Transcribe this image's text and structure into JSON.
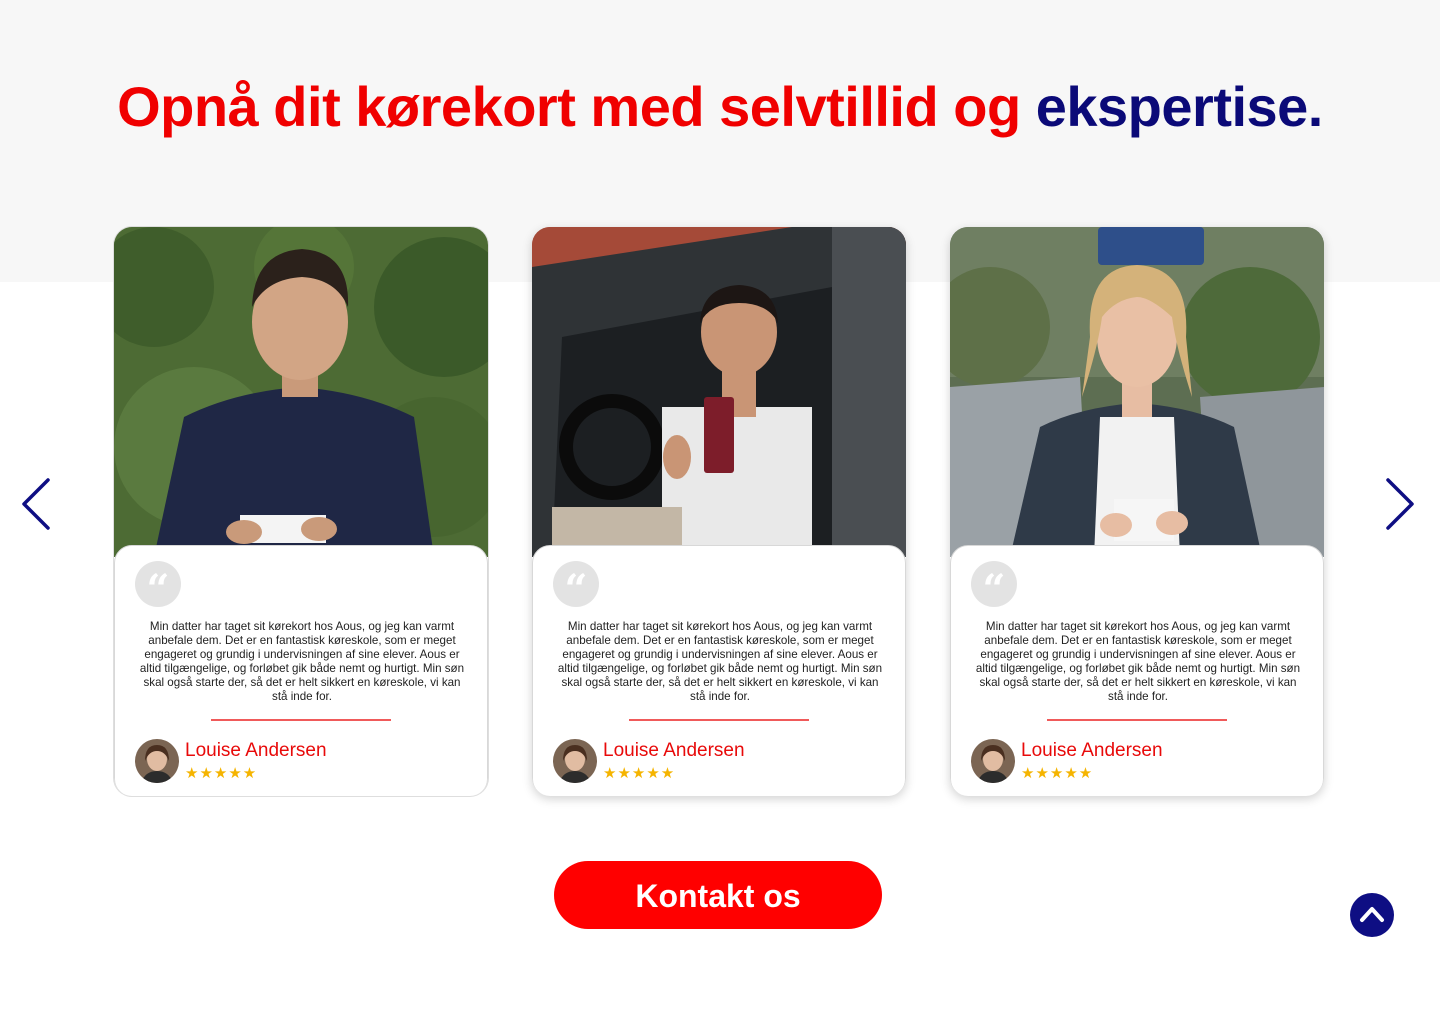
{
  "headline": {
    "red_part": "Opnå dit kørekort med selvtillid og",
    "blue_part": "ekspertise."
  },
  "colors": {
    "accent_red": "#f00000",
    "brand_blue": "#0b0a78",
    "star_gold": "#f5b400"
  },
  "carousel": {
    "prev_icon": "chevron-left-icon",
    "next_icon": "chevron-right-icon",
    "cards": [
      {
        "review": "Min datter har taget sit kørekort hos Aous, og jeg kan varmt anbefale dem. Det er en fantastisk køreskole, som er meget engageret og grundig i undervisningen af sine elever. Aous er altid tilgængelige, og forløbet gik både nemt og hurtigt. Min søn skal også starte der, så det er helt sikkert en køreskole, vi kan stå inde for.",
        "author": "Louise Andersen",
        "stars": "★★★★★",
        "rating": 5
      },
      {
        "review": "Min datter har taget sit kørekort hos Aous, og jeg kan varmt anbefale dem. Det er en fantastisk køreskole, som er meget engageret og grundig i undervisningen af sine elever. Aous er altid tilgængelige, og forløbet gik både nemt og hurtigt. Min søn skal også starte der, så det er helt sikkert en køreskole, vi kan stå inde for.",
        "author": "Louise Andersen",
        "stars": "★★★★★",
        "rating": 5
      },
      {
        "review": "Min datter har taget sit kørekort hos Aous, og jeg kan varmt anbefale dem. Det er en fantastisk køreskole, som er meget engageret og grundig i undervisningen af sine elever. Aous er altid tilgængelige, og forløbet gik både nemt og hurtigt. Min søn skal også starte der, så det er helt sikkert en køreskole, vi kan stå inde for.",
        "author": "Louise Andersen",
        "stars": "★★★★★",
        "rating": 5
      }
    ]
  },
  "cta": {
    "label": "Kontakt os"
  },
  "scroll_top": {
    "icon": "chevron-up-icon"
  }
}
